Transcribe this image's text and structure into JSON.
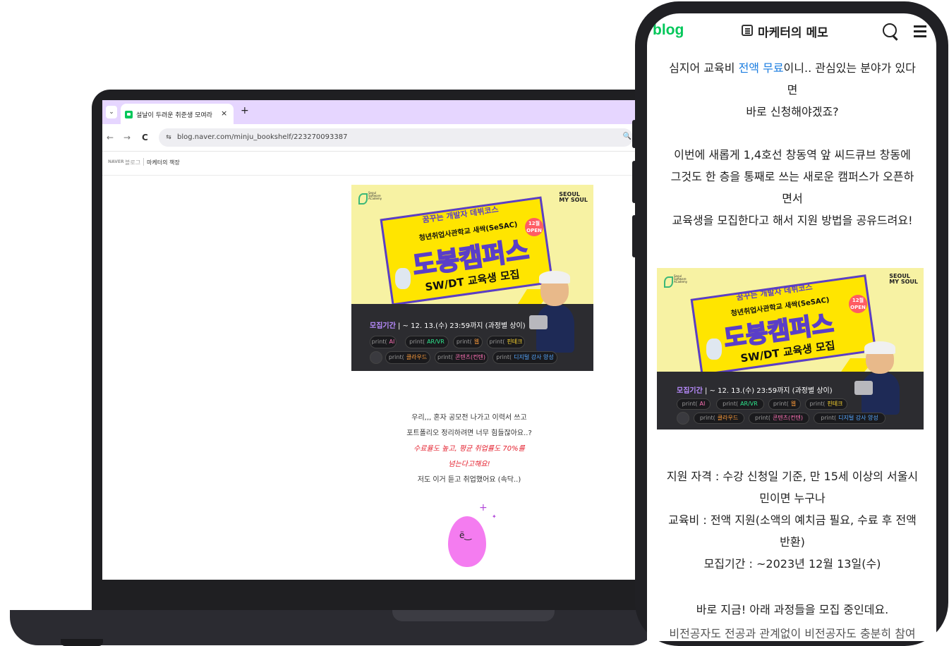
{
  "laptop": {
    "tab": {
      "dropdown_icon": "chevron-down-icon",
      "title": "설날이 두려운 취준생 모여라 :",
      "close": "×",
      "new_tab": "+"
    },
    "nav": {
      "back": "←",
      "forward": "→",
      "reload": "C",
      "site_info": "⇆",
      "url": "blog.naver.com/minju_bookshelf/223270093387",
      "zoom": "🔍"
    },
    "blog_header": {
      "naver": "NAVER",
      "blog": "블로그",
      "title": "마케터의 책장"
    },
    "post_lines": [
      "우리,,, 혼자 공모전 나가고 이력서 쓰고",
      "포트폴리오 정리하려면 너무 힘들잖아요..?",
      "수료율도 높고, 평균 취업률도 70%를",
      "넘는다고해요!",
      "저도 이거 듣고 취업했어요 (속닥..)"
    ],
    "mascot_face": "ë‿"
  },
  "banner": {
    "logo_text": [
      "Seoul",
      "Software",
      "ACademy"
    ],
    "brand": [
      "SEOUL",
      "MY SOUL"
    ],
    "slogan": "꿈꾸는 개발자 데뷔코스",
    "org": "청년취업사관학교 새싹(SeSAC)",
    "open_month": "12월",
    "open_label": "OPEN",
    "campus": "도봉캠퍼스",
    "headline": "SW/DT 교육생 모집",
    "period_label": "모집기간",
    "period_value": "~ 12. 13.(수) 23:59까지 (과정별 상이)",
    "pills_row1": [
      "AI",
      "AR/VR",
      "웹",
      "핀테크"
    ],
    "pills_row2": [
      "클라우드",
      "콘텐츠(컨텐)",
      "디지털 강사 양성"
    ],
    "pill_prefix": "print("
  },
  "phone": {
    "logo": "blog",
    "title": "마케터의 메모",
    "search_icon": "search-icon",
    "menu_icon": "hamburger-menu-icon",
    "intro": {
      "line1_a": "심지어 교육비 ",
      "line1_b": "전액 무료",
      "line1_c": "이니.. 관심있는 분야가 있다",
      "line2": "면",
      "line3": "바로 신청해야겠죠?"
    },
    "paragraph": [
      "이번에 새롭게 1,4호선 창동역 앞 씨드큐브 창동에",
      "그것도 한 층을 통째로 쓰는 새로운 캠퍼스가 오픈하",
      "면서",
      "교육생을 모집한다고 해서 지원 방법을 공유드려요!"
    ],
    "details": [
      "지원 자격 : 수강 신청일 기준, 만 15세 이상의 서울시",
      "민이면 누구나",
      "교육비 : 전액 지원(소액의 예치금 필요, 수료 후 전액",
      "반환)",
      "모집기간 : ~2023년 12월 13일(수)"
    ],
    "now_recruiting": "바로 지금! 아래 과정들을 모집 중인데요.",
    "cut_line": "비전공자도 전공과 관계없이 비전공자도 충분히 참여"
  }
}
